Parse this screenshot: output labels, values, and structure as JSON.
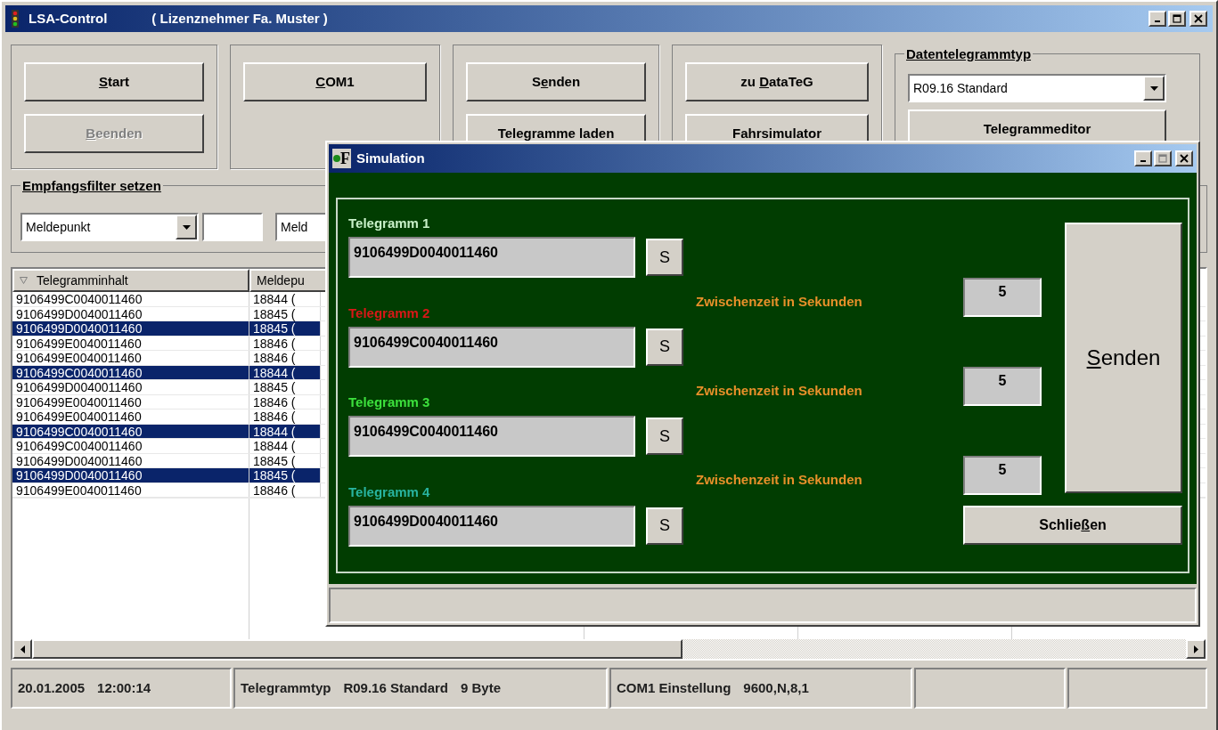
{
  "window": {
    "title": "LSA-Control",
    "subtitle": "( Lizenznehmer Fa. Muster )"
  },
  "toolbar_groups": [
    {
      "buttons": [
        {
          "access_key": "S",
          "after": "tart",
          "disabled": false
        },
        {
          "access_key": "B",
          "after": "eenden",
          "disabled": true
        }
      ]
    },
    {
      "buttons": [
        {
          "access_key": "C",
          "after": "OM1",
          "disabled": false
        }
      ]
    },
    {
      "buttons": [
        {
          "before": "S",
          "access_key": "e",
          "after": "nden",
          "disabled": false
        },
        {
          "label": "Telegramme laden",
          "disabled": false
        }
      ]
    },
    {
      "buttons": [
        {
          "before": "zu ",
          "access_key": "D",
          "after": "ataTeG",
          "disabled": false
        },
        {
          "label": "Fahrsimulator",
          "disabled": false
        }
      ]
    }
  ],
  "telegram_type": {
    "title": "Datentelegrammtyp",
    "value": "R09.16 Standard",
    "button": "Telegrammeditor"
  },
  "filter": {
    "title": "Empfangsfilter setzen",
    "select_1": "Meldepunkt",
    "select_2": "Meld"
  },
  "table": {
    "columns": [
      "Telegramminhalt",
      "Meldepu"
    ],
    "rows": [
      {
        "cells": [
          "9106499C0040011460",
          "18844 ("
        ],
        "selected": false
      },
      {
        "cells": [
          "9106499D0040011460",
          "18845 ("
        ],
        "selected": false
      },
      {
        "cells": [
          "9106499D0040011460",
          "18845 ("
        ],
        "selected": true
      },
      {
        "cells": [
          "9106499E0040011460",
          "18846 ("
        ],
        "selected": false
      },
      {
        "cells": [
          "9106499E0040011460",
          "18846 ("
        ],
        "selected": false
      },
      {
        "cells": [
          "9106499C0040011460",
          "18844 ("
        ],
        "selected": true
      },
      {
        "cells": [
          "9106499D0040011460",
          "18845 ("
        ],
        "selected": false
      },
      {
        "cells": [
          "9106499E0040011460",
          "18846 ("
        ],
        "selected": false
      },
      {
        "cells": [
          "9106499E0040011460",
          "18846 ("
        ],
        "selected": false
      },
      {
        "cells": [
          "9106499C0040011460",
          "18844 ("
        ],
        "selected": true
      },
      {
        "cells": [
          "9106499C0040011460",
          "18844 ("
        ],
        "selected": false
      },
      {
        "cells": [
          "9106499D0040011460",
          "18845 ("
        ],
        "selected": false
      },
      {
        "cells": [
          "9106499D0040011460",
          "18845 ("
        ],
        "selected": true
      },
      {
        "cells": [
          "9106499E0040011460",
          "18846 ("
        ],
        "selected": false
      }
    ]
  },
  "status_bar": [
    [
      "20.01.2005",
      "12:00:14"
    ],
    [
      "Telegrammtyp",
      "R09.16 Standard",
      "9 Byte"
    ],
    [
      "COM1 Einstellung",
      "9600,N,8,1"
    ]
  ],
  "dialog": {
    "title": "Simulation",
    "icon_letter": "F",
    "telegrams": [
      {
        "label": "Telegramm 1",
        "color": "#c8f0c8",
        "value": "9106499D0040011460",
        "button": "S"
      },
      {
        "label": "Telegramm 2",
        "color": "#d81818",
        "value": "9106499C0040011460",
        "button": "S"
      },
      {
        "label": "Telegramm 3",
        "color": "#3ce03c",
        "value": "9106499C0040011460",
        "button": "S"
      },
      {
        "label": "Telegramm 4",
        "color": "#28b4a0",
        "value": "9106499D0040011460",
        "button": "S"
      }
    ],
    "intervals": [
      {
        "label": "Zwischenzeit in Sekunden",
        "value": "5"
      },
      {
        "label": "Zwischenzeit in Sekunden",
        "value": "5"
      },
      {
        "label": "Zwischenzeit in Sekunden",
        "value": "5"
      }
    ],
    "send_button": {
      "access_key": "S",
      "after": "enden"
    },
    "close_button": {
      "before": "Schlie",
      "access_key": "ß",
      "after": "en"
    }
  }
}
